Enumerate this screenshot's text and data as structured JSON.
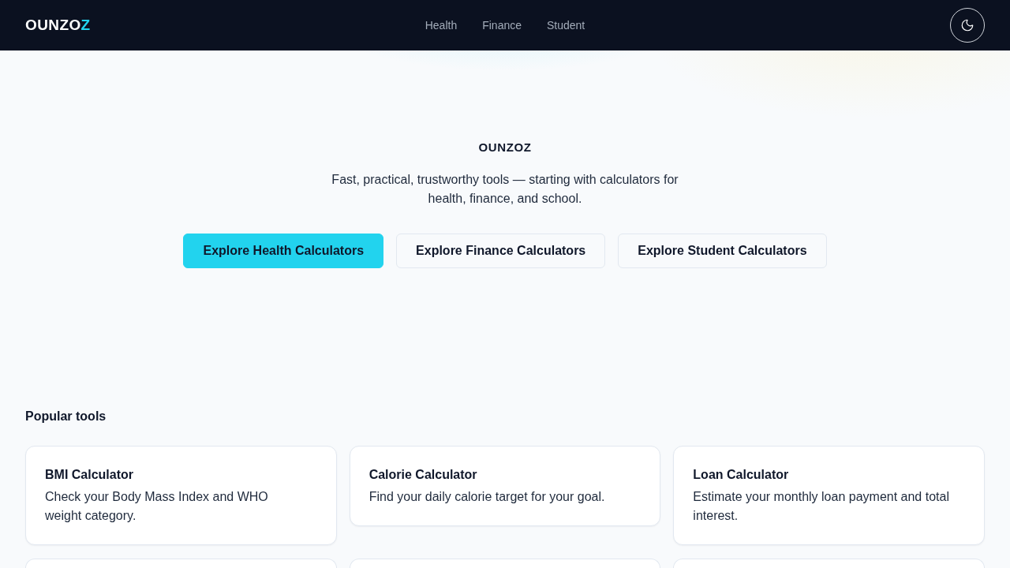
{
  "header": {
    "logo": {
      "main": "OUNZO",
      "accent": "Z"
    },
    "nav": [
      {
        "label": "Health"
      },
      {
        "label": "Finance"
      },
      {
        "label": "Student"
      }
    ]
  },
  "hero": {
    "title": "OUNZOZ",
    "subtitle": "Fast, practical, trustworthy tools — starting with calculators for health, finance, and school.",
    "buttons": [
      {
        "label": "Explore Health Calculators",
        "kind": "primary"
      },
      {
        "label": "Explore Finance Calculators",
        "kind": "secondary"
      },
      {
        "label": "Explore Student Calculators",
        "kind": "secondary"
      }
    ]
  },
  "popular_tools": {
    "heading": "Popular tools",
    "cards": [
      {
        "kind": "tool",
        "title": "BMI Calculator",
        "description": "Check your Body Mass Index and WHO weight category."
      },
      {
        "kind": "tool",
        "title": "Calorie Calculator",
        "description": "Find your daily calorie target for your goal."
      },
      {
        "kind": "tool",
        "title": "Loan Calculator",
        "description": "Estimate your monthly loan payment and total interest."
      },
      {
        "kind": "clipped"
      },
      {
        "kind": "clipped"
      },
      {
        "kind": "clipped"
      }
    ]
  }
}
